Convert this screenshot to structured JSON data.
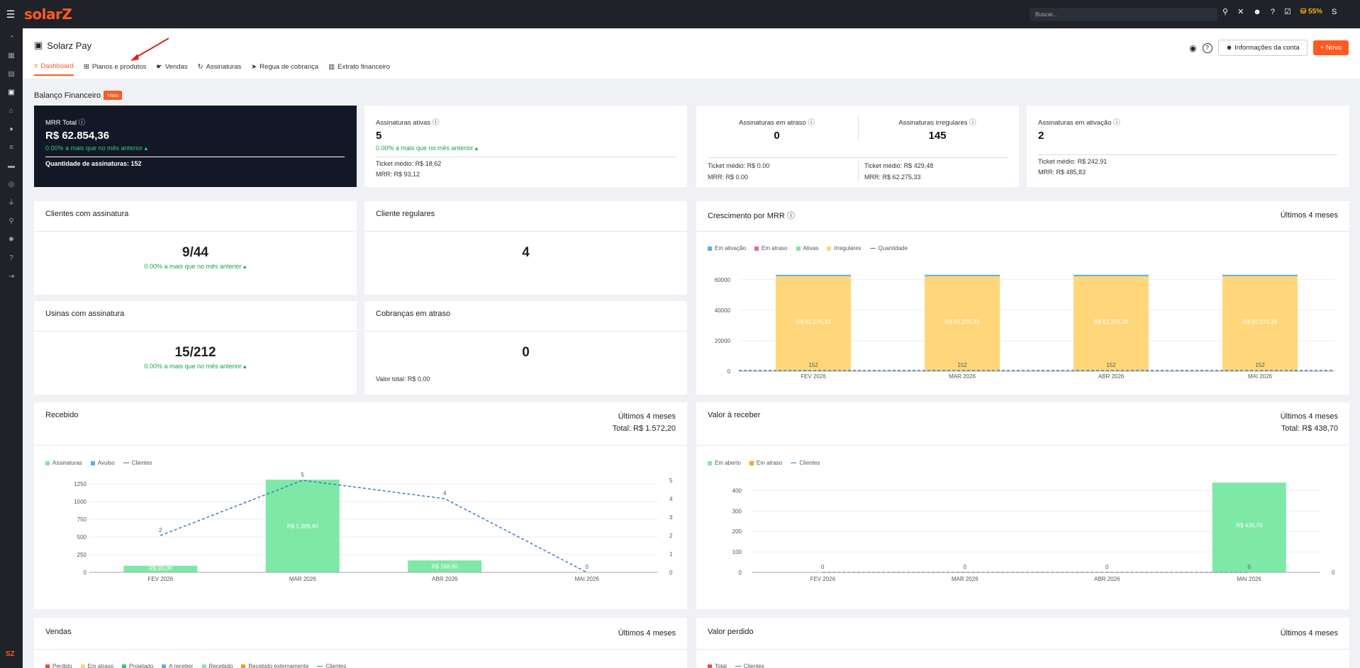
{
  "topbar": {
    "logo": "solarZ",
    "search_placeholder": "Buscar...",
    "coins": "55%"
  },
  "sidebar": {
    "bottom_logo": "SZ"
  },
  "header": {
    "title": "Solarz Pay",
    "tabs": [
      "Dashboard",
      "Planos e produtos",
      "Vendas",
      "Assinaturas",
      "Regua de cobrança",
      "Extrato financeiro"
    ],
    "account_button": "Informações da conta",
    "new_button": "Novo"
  },
  "balance": {
    "title": "Balanço Financeiro",
    "badge": "Maio"
  },
  "mrr": {
    "label": "MRR Total",
    "value": "R$ 62.854,36",
    "change": "0.00% a mais que no mês anterior",
    "qty": "Quantidade de assinaturas: 152"
  },
  "ativas": {
    "label": "Assinaturas ativas",
    "value": "5",
    "change": "0.00% a mais que no mês anterior",
    "ticket": "Ticket médio: R$ 18,62",
    "mrr": "MRR: R$ 93,12"
  },
  "atraso": {
    "label": "Assinaturas em atraso",
    "value": "0",
    "ticket": "Ticket médio: R$ 0.00",
    "mrr": "MRR: R$ 0.00"
  },
  "irregulares": {
    "label": "Assinaturas irregulares",
    "value": "145",
    "ticket": "Ticket médio: R$ 429,48",
    "mrr": "MRR: R$ 62.275,33"
  },
  "ativacao": {
    "label": "Assinaturas em ativação",
    "value": "2",
    "ticket": "Ticket médio: R$ 242,91",
    "mrr": "MRR: R$ 485,83"
  },
  "clientes_assinatura": {
    "title": "Clientes com assinatura",
    "value": "9/44",
    "change": "0.00% a mais que no mês anterior"
  },
  "clientes_regulares": {
    "title": "Cliente regulares",
    "value": "4"
  },
  "usinas": {
    "title": "Usinas com assinatura",
    "value": "15/212",
    "change": "0.00% a mais que no mês anterior"
  },
  "cobrancas": {
    "title": "Cobranças em atraso",
    "value": "0",
    "total": "Valor total: R$ 0,00"
  },
  "crescimento": {
    "title": "Crescimento por MRR",
    "period": "Últimos 4 meses"
  },
  "recebido": {
    "title": "Recebido",
    "period": "Últimos 4 meses",
    "total": "Total: R$ 1.572,20"
  },
  "receber": {
    "title": "Valor à receber",
    "period": "Últimos 4 meses",
    "total": "Total: R$ 438,70"
  },
  "vendas": {
    "title": "Vendas",
    "period": "Últimos 4 meses",
    "legend": [
      "Perdido",
      "Em atraso",
      "Projetado",
      "A receber",
      "Recebido",
      "Recebido externamente",
      "Clientes"
    ]
  },
  "perdido": {
    "title": "Valor perdido",
    "period": "Últimos 4 meses",
    "legend": [
      "Total",
      "Clientes"
    ]
  },
  "chart_data": [
    {
      "type": "bar",
      "title": "Crescimento por MRR",
      "categories": [
        "FEV 2026",
        "MAR 2026",
        "ABR 2026",
        "MAI 2026"
      ],
      "series": [
        {
          "name": "Em ativação",
          "values": [
            0,
            0,
            0,
            0
          ],
          "color": "#5dade2"
        },
        {
          "name": "Em atraso",
          "values": [
            0,
            0,
            0,
            0
          ],
          "color": "#f06292"
        },
        {
          "name": "Ativas",
          "values": [
            0,
            0,
            0,
            0
          ],
          "color": "#7ee8a6"
        },
        {
          "name": "Irregulares",
          "values": [
            62275.33,
            62275.33,
            62275.33,
            62275.33
          ],
          "color": "#ffd77a"
        },
        {
          "name": "Quantidade",
          "values": [
            152,
            152,
            152,
            152
          ],
          "color": "#3b7dc2"
        }
      ],
      "bar_labels": [
        "R$ 62.275,33",
        "R$ 62.275,33",
        "R$ 62.275,33",
        "R$ 62.275,33"
      ],
      "yticks": [
        0,
        20000,
        40000,
        60000
      ],
      "ylim": [
        0,
        65000
      ]
    },
    {
      "type": "bar",
      "title": "Recebido",
      "categories": [
        "FEV 2026",
        "MAR 2026",
        "ABR 2026",
        "MAI 2026"
      ],
      "series": [
        {
          "name": "Assinaturas",
          "values": [
            93.0,
            1308.4,
            168.8,
            0
          ],
          "color": "#7ee8a6"
        },
        {
          "name": "Avulso",
          "values": [
            0,
            0,
            0,
            0
          ],
          "color": "#5dade2"
        },
        {
          "name": "Clientes",
          "values": [
            2,
            5,
            4,
            0
          ],
          "color": "#3b7dc2"
        }
      ],
      "bar_labels": [
        "R$ 93,00",
        "R$ 1.308,40",
        "R$ 168,80",
        ""
      ],
      "yticks": [
        0,
        250,
        500,
        750,
        1000,
        1250
      ],
      "y2ticks": [
        0,
        1,
        2,
        3,
        4,
        5
      ],
      "ylim": [
        0,
        1300
      ],
      "y2lim": [
        0,
        5
      ]
    },
    {
      "type": "bar",
      "title": "Valor à receber",
      "categories": [
        "FEV 2026",
        "MAR 2026",
        "ABR 2026",
        "MAI 2026"
      ],
      "series": [
        {
          "name": "Em aberto",
          "values": [
            0,
            0,
            0,
            438.7
          ],
          "color": "#7ee8a6"
        },
        {
          "name": "Em atraso",
          "values": [
            0,
            0,
            0,
            0
          ],
          "color": "#f5a623"
        },
        {
          "name": "Clientes",
          "values": [
            0,
            0,
            0,
            0
          ],
          "color": "#3b7dc2"
        }
      ],
      "bar_labels": [
        "",
        "",
        "",
        "R$ 438,70"
      ],
      "yticks": [
        0,
        100,
        200,
        300,
        400
      ],
      "y2ticks": [
        0
      ],
      "ylim": [
        0,
        450
      ]
    }
  ]
}
